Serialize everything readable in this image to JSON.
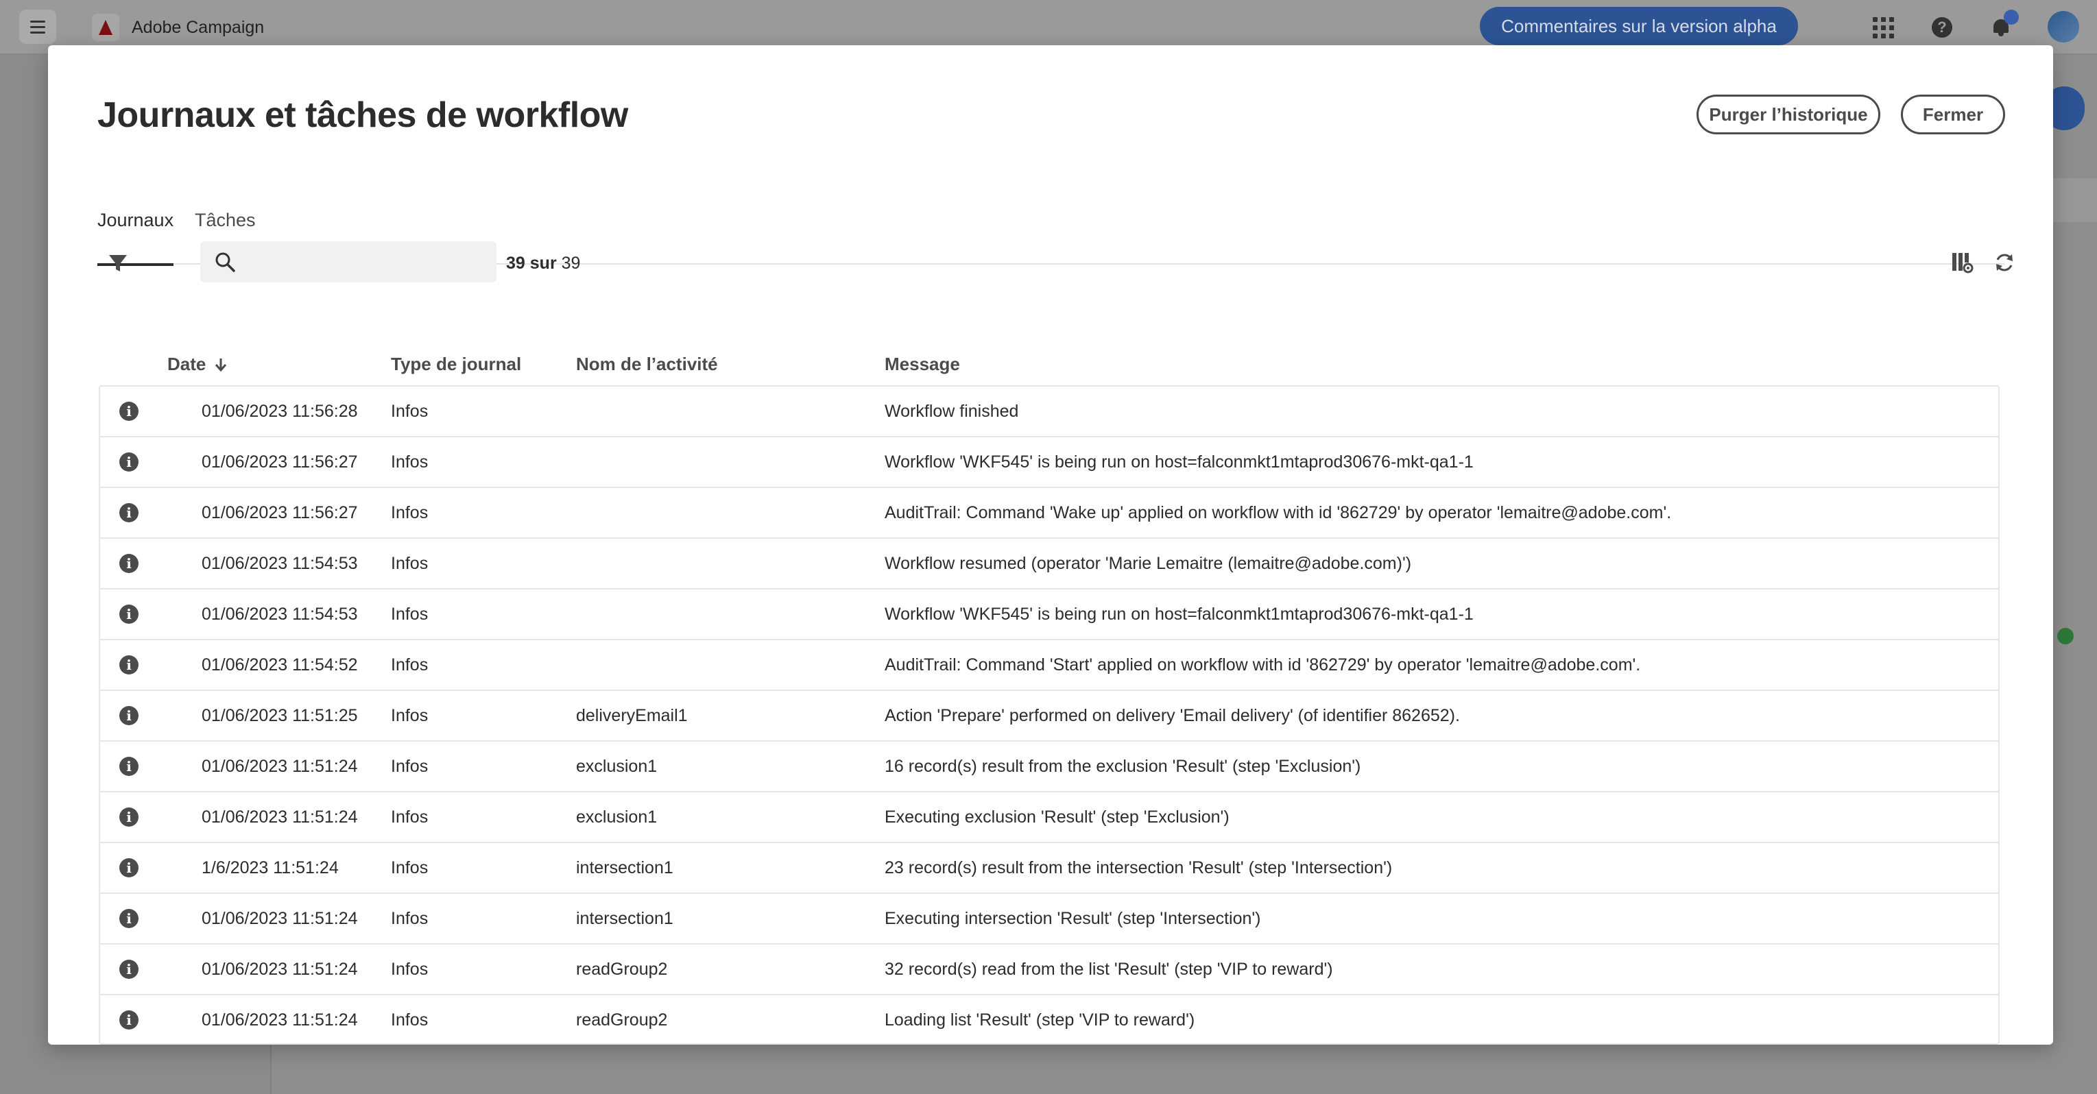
{
  "app": {
    "brand_name": "Adobe Campaign",
    "alpha_feedback_label": "Commentaires sur la version alpha"
  },
  "modal": {
    "title": "Journaux et tâches de workflow",
    "purge_label": "Purger l’historique",
    "close_label": "Fermer",
    "tabs": [
      {
        "label": "Journaux",
        "selected": true
      },
      {
        "label": "Tâches",
        "selected": false
      }
    ],
    "search": {
      "placeholder": "",
      "value": ""
    },
    "count": {
      "shown": "39",
      "separator": "sur",
      "total": "39"
    }
  },
  "table": {
    "columns": [
      "Date",
      "Type de journal",
      "Nom de l’activité",
      "Message"
    ],
    "sort": {
      "column": "Date",
      "direction": "descending"
    },
    "rows": [
      {
        "date": "01/06/2023 11:56:28",
        "type": "Infos",
        "activity": "",
        "message": "Workflow finished"
      },
      {
        "date": "01/06/2023 11:56:27",
        "type": "Infos",
        "activity": "",
        "message": "Workflow 'WKF545' is being run on host=falconmkt1mtaprod30676-mkt-qa1-1"
      },
      {
        "date": "01/06/2023 11:56:27",
        "type": "Infos",
        "activity": "",
        "message": "AuditTrail: Command 'Wake up' applied on workflow with id '862729' by operator 'lemaitre@adobe.com'."
      },
      {
        "date": "01/06/2023 11:54:53",
        "type": "Infos",
        "activity": "",
        "message": "Workflow resumed (operator 'Marie Lemaitre (lemaitre@adobe.com)')"
      },
      {
        "date": "01/06/2023 11:54:53",
        "type": "Infos",
        "activity": "",
        "message": "Workflow 'WKF545' is being run on host=falconmkt1mtaprod30676-mkt-qa1-1"
      },
      {
        "date": "01/06/2023 11:54:52",
        "type": "Infos",
        "activity": "",
        "message": "AuditTrail: Command 'Start' applied on workflow with id '862729' by operator 'lemaitre@adobe.com'."
      },
      {
        "date": "01/06/2023 11:51:25",
        "type": "Infos",
        "activity": "deliveryEmail1",
        "message": "Action 'Prepare' performed on delivery 'Email delivery' (of identifier 862652)."
      },
      {
        "date": "01/06/2023 11:51:24",
        "type": "Infos",
        "activity": "exclusion1",
        "message": "16 record(s) result from the exclusion 'Result' (step 'Exclusion')"
      },
      {
        "date": "01/06/2023 11:51:24",
        "type": "Infos",
        "activity": "exclusion1",
        "message": "Executing exclusion 'Result' (step 'Exclusion')"
      },
      {
        "date": "1/6/2023 11:51:24",
        "type": "Infos",
        "activity": "intersection1",
        "message": "23 record(s) result from the intersection 'Result' (step 'Intersection')"
      },
      {
        "date": "01/06/2023 11:51:24",
        "type": "Infos",
        "activity": "intersection1",
        "message": "Executing intersection 'Result' (step 'Intersection')"
      },
      {
        "date": "01/06/2023 11:51:24",
        "type": "Infos",
        "activity": "readGroup2",
        "message": "32 record(s) read from the list 'Result' (step 'VIP to reward')"
      },
      {
        "date": "01/06/2023 11:51:24",
        "type": "Infos",
        "activity": "readGroup2",
        "message": "Loading list 'Result' (step 'VIP to reward')"
      }
    ]
  },
  "colors": {
    "accent_blue": "#2c5394",
    "overlay": "#8e8e8e",
    "text_primary": "#2c2c2c",
    "text_secondary": "#4b4b4b",
    "row_border": "#e6e6e6"
  },
  "icons": {
    "menu": "hamburger-icon",
    "brand": "adobe-logo-icon",
    "apps": "app-grid-icon",
    "help": "help-icon",
    "notifications": "bell-icon",
    "filter": "filter-icon",
    "search": "search-icon",
    "sort": "arrow-down-icon",
    "row": "info-icon",
    "columns": "column-settings-icon",
    "refresh": "refresh-icon"
  }
}
